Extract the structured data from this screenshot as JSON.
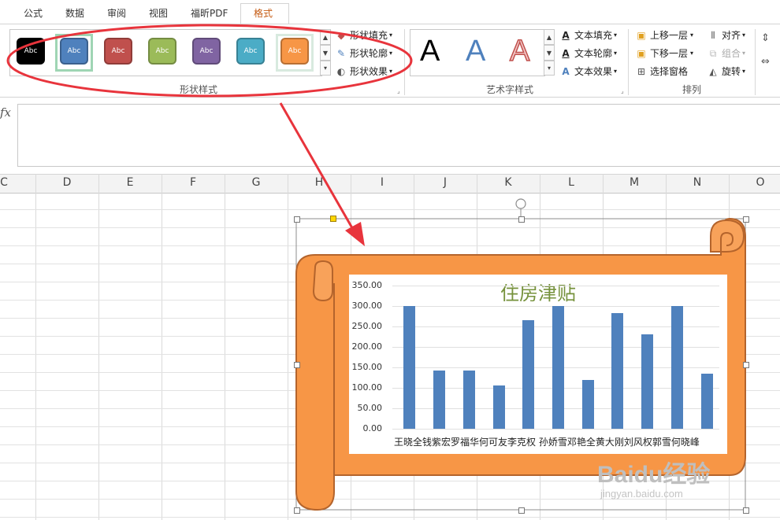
{
  "tabs": [
    "公式",
    "数据",
    "审阅",
    "视图",
    "福昕PDF",
    "格式"
  ],
  "active_tab": "格式",
  "shape_styles": {
    "group_label": "形状样式",
    "swatches": [
      {
        "label": "Abc",
        "color": "#000000"
      },
      {
        "label": "Abc",
        "color": "#4f81bd"
      },
      {
        "label": "Abc",
        "color": "#c0504d"
      },
      {
        "label": "Abc",
        "color": "#9bbb59"
      },
      {
        "label": "Abc",
        "color": "#8064a2"
      },
      {
        "label": "Abc",
        "color": "#4bacc6"
      },
      {
        "label": "Abc",
        "color": "#f79646"
      }
    ],
    "commands": [
      "形状填充",
      "形状轮廓",
      "形状效果"
    ]
  },
  "wordart_styles": {
    "group_label": "艺术字样式",
    "letters": [
      "A",
      "A",
      "A"
    ],
    "commands": [
      "文本填充",
      "文本轮廓",
      "文本效果"
    ]
  },
  "arrange": {
    "group_label": "排列",
    "commands": [
      "上移一层",
      "下移一层",
      "选择窗格",
      "对齐",
      "组合",
      "旋转"
    ]
  },
  "formula_bar": {
    "fx_label": "fx",
    "value": ""
  },
  "columns": [
    "C",
    "D",
    "E",
    "F",
    "G",
    "H",
    "I",
    "J",
    "K",
    "L",
    "M",
    "N",
    "O"
  ],
  "annotation_color": "#e8343c",
  "scroll_color": "#f79646",
  "chart_data": {
    "type": "bar",
    "title": "住房津贴",
    "categories": [
      "王晓全",
      "钱紫宏",
      "罗福华",
      "何可友",
      "李克权",
      "孙娇雪",
      "邓艳全",
      "黄大刚",
      "刘风权",
      "郭雪",
      "何晓峰"
    ],
    "x_label_text": "王晓全钱紫宏罗福华何可友李克权 孙娇雪邓艳全黄大刚刘风权郭雪何晓峰",
    "values": [
      300,
      142,
      142,
      105,
      265,
      300,
      120,
      282,
      230,
      300,
      135
    ],
    "ylim": [
      0,
      350
    ],
    "yticks": [
      "0.00",
      "50.00",
      "100.00",
      "150.00",
      "200.00",
      "250.00",
      "300.00",
      "350.00"
    ],
    "bar_color": "#4f81bd",
    "grid": true,
    "legend": "none"
  },
  "watermark": {
    "logo": "Baidu经验",
    "url": "jingyan.baidu.com"
  }
}
